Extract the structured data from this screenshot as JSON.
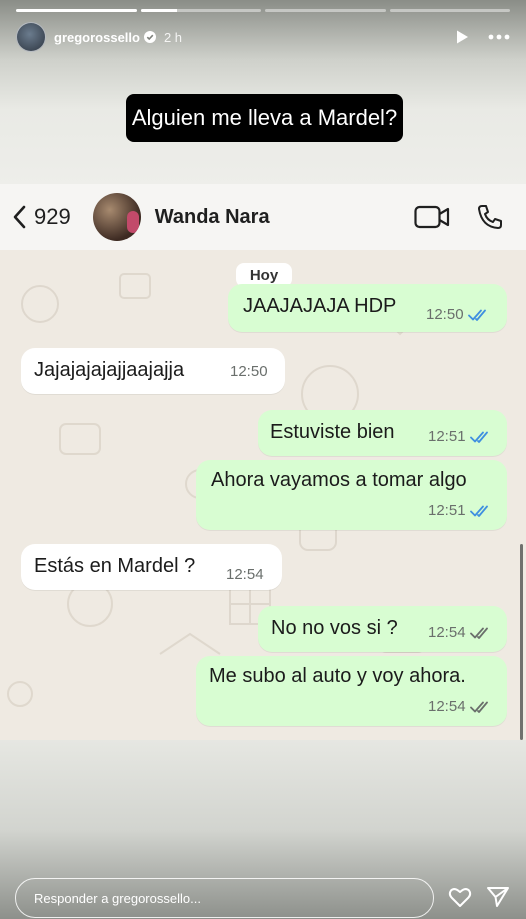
{
  "story": {
    "username": "gregorossello",
    "time": "2 h",
    "caption": "Alguien me lleva a Mardel?",
    "progress": [
      1.0,
      0.3,
      0,
      0
    ],
    "reply_placeholder": "Responder a gregorossello..."
  },
  "chat": {
    "back_count": "929",
    "contact_name": "Wanda Nara",
    "day_label": "Hoy",
    "messages": [
      {
        "direction": "out",
        "text": "JAAJAJAJA HDP",
        "time": "12:50",
        "status": "read"
      },
      {
        "direction": "in",
        "text": "Jajajajajajjaajajja",
        "time": "12:50"
      },
      {
        "direction": "out",
        "text": "Estuviste bien",
        "time": "12:51",
        "status": "read"
      },
      {
        "direction": "out",
        "text": "Ahora vayamos a tomar algo",
        "time": "12:51",
        "status": "read"
      },
      {
        "direction": "in",
        "text": "Estás en Mardel ?",
        "time": "12:54"
      },
      {
        "direction": "out",
        "text": "No no vos si ?",
        "time": "12:54",
        "status": "delivered"
      },
      {
        "direction": "out",
        "text": "Me subo al auto y voy ahora.",
        "time": "12:54",
        "status": "delivered"
      }
    ]
  },
  "colors": {
    "outgoing_bubble": "#d8fdd2",
    "incoming_bubble": "#ffffff",
    "chat_background": "#efeae2",
    "read_tick": "#3f8fe0",
    "delivered_tick": "#6a6f6c"
  },
  "icons": [
    "play-icon",
    "more-icon",
    "back-chevron-icon",
    "video-call-icon",
    "phone-icon",
    "heart-icon",
    "send-icon",
    "verified-icon",
    "double-check-icon"
  ]
}
